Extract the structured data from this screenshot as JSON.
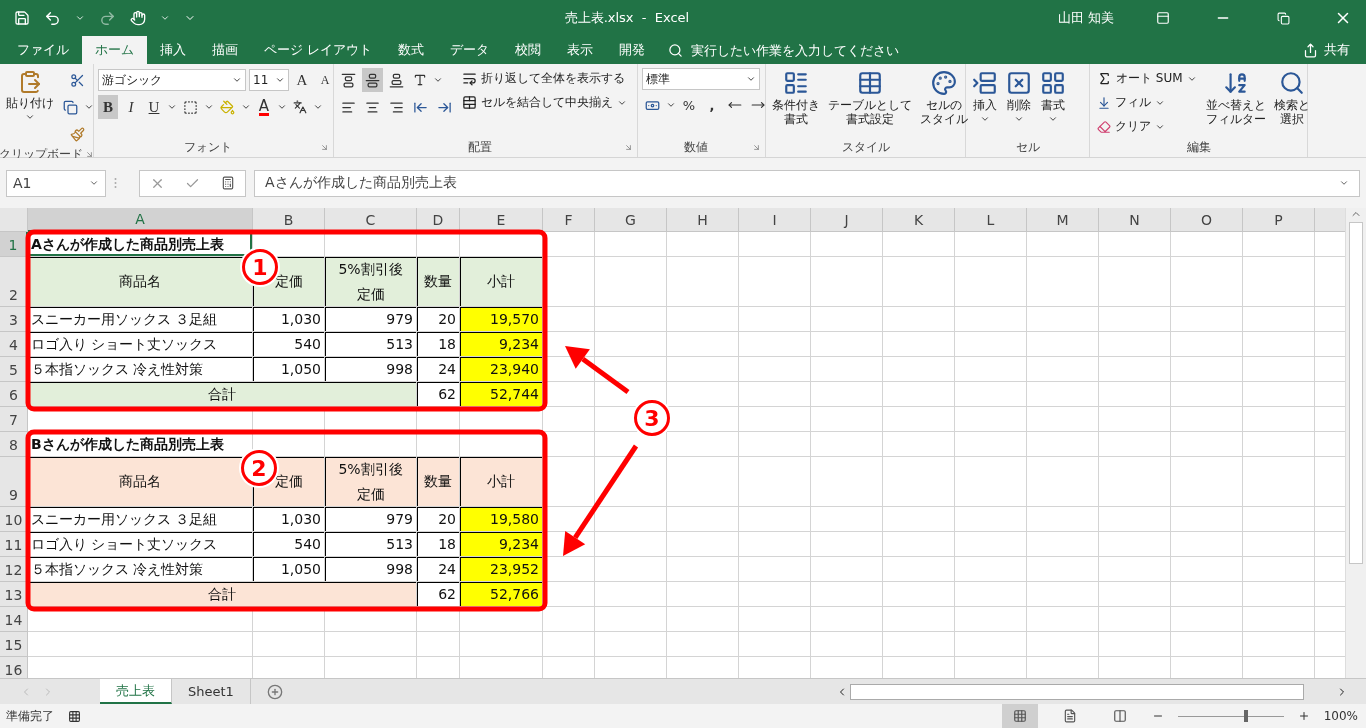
{
  "window": {
    "title": "売上表.xlsx  -  Excel",
    "user": "山田 知美"
  },
  "menu_tabs": [
    {
      "label": "ファイル",
      "selected": false
    },
    {
      "label": "ホーム",
      "selected": true
    },
    {
      "label": "挿入",
      "selected": false
    },
    {
      "label": "描画",
      "selected": false
    },
    {
      "label": "ページ レイアウト",
      "selected": false
    },
    {
      "label": "数式",
      "selected": false
    },
    {
      "label": "データ",
      "selected": false
    },
    {
      "label": "校閲",
      "selected": false
    },
    {
      "label": "表示",
      "selected": false
    },
    {
      "label": "開発",
      "selected": false
    }
  ],
  "tell_me": {
    "placeholder": "実行したい作業を入力してください"
  },
  "share": "共有",
  "ribbon": {
    "clipboard": {
      "paste": "貼り付け",
      "label": "クリップボード"
    },
    "font": {
      "name": "游ゴシック",
      "size": "11",
      "grow": "A",
      "shrink": "A",
      "bold": {
        "label": "B",
        "on": true
      },
      "italic": "I",
      "underline": "U",
      "color_letter": "A",
      "label": "フォント"
    },
    "alignment": {
      "vertical": [
        {
          "selected": false
        },
        {
          "selected": true
        },
        {
          "selected": false
        }
      ],
      "wrap": "折り返して全体を表示する",
      "merge": "セルを結合して中央揃え",
      "label": "配置"
    },
    "number": {
      "format": "標準",
      "percent": "%",
      "comma": ",",
      "label": "数値"
    },
    "styles": {
      "buttons": [
        {
          "lines": [
            "条件付き",
            "書式"
          ]
        },
        {
          "lines": [
            "テーブルとして",
            "書式設定"
          ]
        },
        {
          "lines": [
            "セルの",
            "スタイル"
          ]
        }
      ],
      "label": "スタイル"
    },
    "cells": {
      "buttons": [
        "挿入",
        "削除",
        "書式"
      ],
      "label": "セル"
    },
    "editing": {
      "autosum": "オート SUM",
      "fill": "フィル",
      "clear": "クリア",
      "sort": [
        "並べ替えと",
        "フィルター"
      ],
      "find": [
        "検索と",
        "選択"
      ],
      "label": "編集"
    }
  },
  "formula_bar": {
    "name_box": "A1",
    "value": "Aさんが作成した商品別売上表"
  },
  "columns": [
    {
      "label": "A",
      "selected": true
    },
    {
      "label": "B",
      "selected": false
    },
    {
      "label": "C",
      "selected": false
    },
    {
      "label": "D",
      "selected": false
    },
    {
      "label": "E",
      "selected": false
    },
    {
      "label": "F",
      "selected": false
    },
    {
      "label": "G",
      "selected": false
    },
    {
      "label": "H",
      "selected": false
    },
    {
      "label": "I",
      "selected": false
    },
    {
      "label": "J",
      "selected": false
    },
    {
      "label": "K",
      "selected": false
    },
    {
      "label": "L",
      "selected": false
    },
    {
      "label": "M",
      "selected": false
    },
    {
      "label": "N",
      "selected": false
    },
    {
      "label": "O",
      "selected": false
    },
    {
      "label": "P",
      "selected": false
    }
  ],
  "rows": [
    {
      "label": "1",
      "selected": true,
      "cells": [
        {
          "kind": "title",
          "text": "Aさんが作成した商品別売上表"
        }
      ]
    },
    {
      "label": "2",
      "selected": false,
      "cells": [
        {
          "kind": "header",
          "text": "商品名",
          "color": "#e2efda"
        },
        {
          "kind": "header",
          "text": "定価",
          "color": "#e2efda"
        },
        {
          "kind": "header",
          "lines": [
            "5%割引後",
            "定価"
          ],
          "color": "#e2efda"
        },
        {
          "kind": "header",
          "text": "数量",
          "color": "#e2efda"
        },
        {
          "kind": "header",
          "text": "小計",
          "color": "#e2efda"
        }
      ]
    },
    {
      "label": "3",
      "selected": false,
      "cells": [
        {
          "kind": "text",
          "text": "スニーカー用ソックス ３足組",
          "color": "#ffffff"
        },
        {
          "kind": "number",
          "text": "1,030",
          "color": "#ffffff"
        },
        {
          "kind": "number",
          "text": "979",
          "color": "#ffffff"
        },
        {
          "kind": "number",
          "text": "20",
          "color": "#ffffff"
        },
        {
          "kind": "number",
          "text": "19,570",
          "color": "#ffff00"
        }
      ]
    },
    {
      "label": "4",
      "selected": false,
      "cells": [
        {
          "kind": "text",
          "text": "ロゴ入り ショート丈ソックス",
          "color": "#ffffff"
        },
        {
          "kind": "number",
          "text": "540",
          "color": "#ffffff"
        },
        {
          "kind": "number",
          "text": "513",
          "color": "#ffffff"
        },
        {
          "kind": "number",
          "text": "18",
          "color": "#ffffff"
        },
        {
          "kind": "number",
          "text": "9,234",
          "color": "#ffff00"
        }
      ]
    },
    {
      "label": "5",
      "selected": false,
      "cells": [
        {
          "kind": "text",
          "text": "５本指ソックス 冷え性対策",
          "color": "#ffffff"
        },
        {
          "kind": "number",
          "text": "1,050",
          "color": "#ffffff"
        },
        {
          "kind": "number",
          "text": "998",
          "color": "#ffffff"
        },
        {
          "kind": "number",
          "text": "24",
          "color": "#ffffff"
        },
        {
          "kind": "number",
          "text": "23,940",
          "color": "#ffff00"
        }
      ]
    },
    {
      "label": "6",
      "selected": false,
      "cells": [
        {
          "kind": "total",
          "text": "合計",
          "color": "#e2efda"
        },
        {
          "kind": "number",
          "text": "62",
          "color": "#ffffff"
        },
        {
          "kind": "number",
          "text": "52,744",
          "color": "#ffff00"
        }
      ]
    },
    {
      "label": "7",
      "selected": false
    },
    {
      "label": "8",
      "selected": false,
      "cells": [
        {
          "kind": "title",
          "text": "Bさんが作成した商品別売上表"
        }
      ]
    },
    {
      "label": "9",
      "selected": false,
      "cells": [
        {
          "kind": "header",
          "text": "商品名",
          "color": "#fce4d6"
        },
        {
          "kind": "header",
          "text": "定価",
          "color": "#fce4d6"
        },
        {
          "kind": "header",
          "lines": [
            "5%割引後",
            "定価"
          ],
          "color": "#fce4d6"
        },
        {
          "kind": "header",
          "text": "数量",
          "color": "#fce4d6"
        },
        {
          "kind": "header",
          "text": "小計",
          "color": "#fce4d6"
        }
      ]
    },
    {
      "label": "10",
      "selected": false,
      "cells": [
        {
          "kind": "text",
          "text": "スニーカー用ソックス ３足組",
          "color": "#ffffff"
        },
        {
          "kind": "number",
          "text": "1,030",
          "color": "#ffffff"
        },
        {
          "kind": "number",
          "text": "979",
          "color": "#ffffff"
        },
        {
          "kind": "number",
          "text": "20",
          "color": "#ffffff"
        },
        {
          "kind": "number",
          "text": "19,580",
          "color": "#ffff00"
        }
      ]
    },
    {
      "label": "11",
      "selected": false,
      "cells": [
        {
          "kind": "text",
          "text": "ロゴ入り ショート丈ソックス",
          "color": "#ffffff"
        },
        {
          "kind": "number",
          "text": "540",
          "color": "#ffffff"
        },
        {
          "kind": "number",
          "text": "513",
          "color": "#ffffff"
        },
        {
          "kind": "number",
          "text": "18",
          "color": "#ffffff"
        },
        {
          "kind": "number",
          "text": "9,234",
          "color": "#ffff00"
        }
      ]
    },
    {
      "label": "12",
      "selected": false,
      "cells": [
        {
          "kind": "text",
          "text": "５本指ソックス 冷え性対策",
          "color": "#ffffff"
        },
        {
          "kind": "number",
          "text": "1,050",
          "color": "#ffffff"
        },
        {
          "kind": "number",
          "text": "998",
          "color": "#ffffff"
        },
        {
          "kind": "number",
          "text": "24",
          "color": "#ffffff"
        },
        {
          "kind": "number",
          "text": "23,952",
          "color": "#ffff00"
        }
      ]
    },
    {
      "label": "13",
      "selected": false,
      "cells": [
        {
          "kind": "total",
          "text": "合計",
          "color": "#fce4d6"
        },
        {
          "kind": "number",
          "text": "62",
          "color": "#ffffff"
        },
        {
          "kind": "number",
          "text": "52,766",
          "color": "#ffff00"
        }
      ]
    },
    {
      "label": "14",
      "selected": false
    },
    {
      "label": "15",
      "selected": false
    },
    {
      "label": "16",
      "selected": false
    }
  ],
  "annotations": [
    {
      "label": "1"
    },
    {
      "label": "2"
    },
    {
      "label": "3"
    }
  ],
  "sheet_tabs": [
    {
      "label": "売上表",
      "selected": true
    },
    {
      "label": "Sheet1",
      "selected": false
    }
  ],
  "status": {
    "text": "準備完了",
    "views": [
      {
        "selected": true
      },
      {
        "selected": false
      },
      {
        "selected": false
      }
    ],
    "zoom": {
      "level": 0.64
    },
    "zoom_text": "100%"
  }
}
